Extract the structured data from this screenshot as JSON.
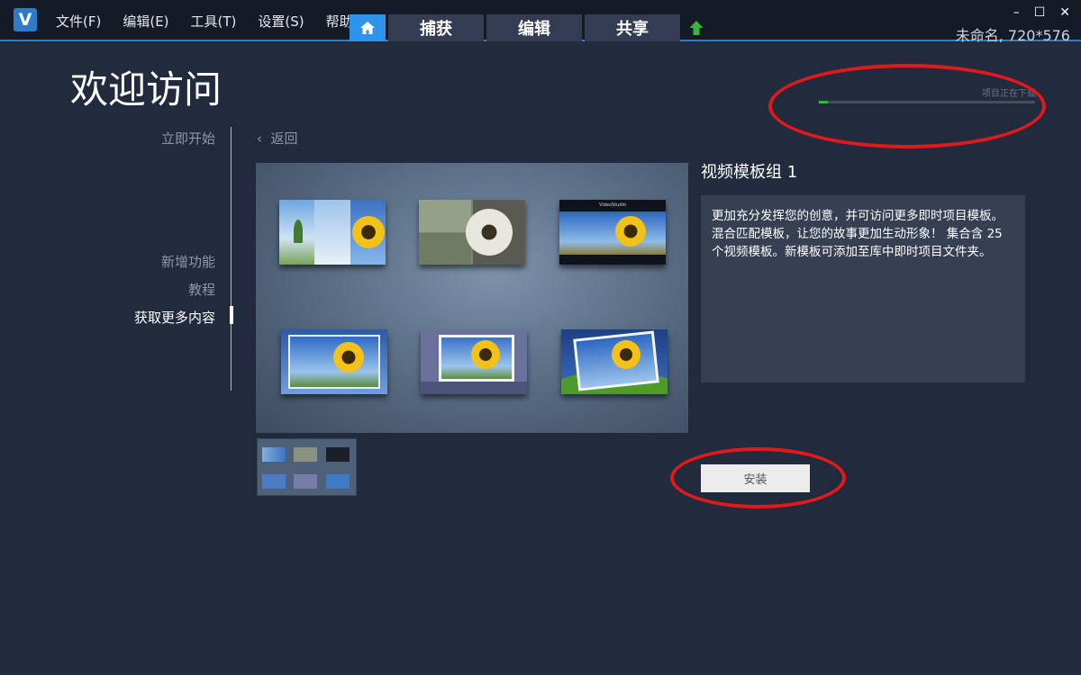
{
  "menu": {
    "items": [
      "文件(F)",
      "编辑(E)",
      "工具(T)",
      "设置(S)",
      "帮助"
    ]
  },
  "tabs": {
    "home_icon": "home-icon",
    "items": [
      "捕获",
      "编辑",
      "共享"
    ],
    "upload_icon": "upload-arrow-icon"
  },
  "window": {
    "project_info": "未命名, 720*576",
    "minimize": "–",
    "maximize": "☐",
    "close": "✕"
  },
  "page": {
    "title": "欢迎访问"
  },
  "download": {
    "status_text": "项目正在下载",
    "progress": 0.04,
    "color": "#2fbb3e"
  },
  "sidebar": {
    "items": [
      {
        "label": "立即开始",
        "active": false
      },
      {
        "label": "新增功能",
        "active": false
      },
      {
        "label": "教程",
        "active": false
      },
      {
        "label": "获取更多内容",
        "active": true
      }
    ]
  },
  "content": {
    "back_label": "返回",
    "pack_title": "视频模板组 1",
    "description": "更加充分发挥您的创意，并可访问更多即时项目模板。混合匹配模板，让您的故事更加生动形象！ 集合含 25 个视频模板。新模板可添加至库中即时项目文件夹。",
    "install_label": "安装",
    "template_brand": "VideoStudio"
  },
  "colors": {
    "accent": "#2e93ea",
    "annotation": "#e01a1a",
    "background": "#222a3d"
  }
}
